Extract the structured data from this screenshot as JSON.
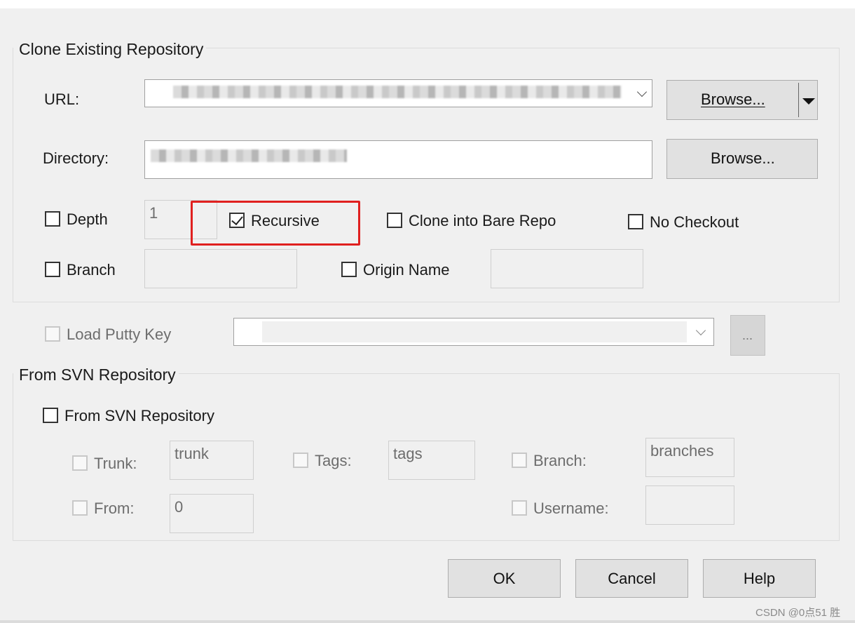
{
  "clone_group": {
    "title": "Clone Existing Repository",
    "url_label": "URL:",
    "directory_label": "Directory:",
    "browse_label": "Browse...",
    "depth_label": "Depth",
    "depth_value": "1",
    "recursive_label": "Recursive",
    "bare_label": "Clone into Bare Repo",
    "no_checkout_label": "No Checkout",
    "branch_label": "Branch",
    "origin_label": "Origin Name"
  },
  "putty": {
    "label": "Load Putty Key",
    "browse_label": "..."
  },
  "svn_group": {
    "title": "From SVN Repository",
    "checkbox_label": "From SVN Repository",
    "trunk_label": "Trunk:",
    "trunk_value": "trunk",
    "tags_label": "Tags:",
    "tags_value": "tags",
    "branch_label": "Branch:",
    "branch_value": "branches",
    "from_label": "From:",
    "from_value": "0",
    "username_label": "Username:"
  },
  "buttons": {
    "ok": "OK",
    "cancel": "Cancel",
    "help": "Help"
  },
  "watermark": "CSDN @0点51 胜",
  "colors": {
    "background": "#f0f0f0",
    "highlight": "#e0201f"
  }
}
